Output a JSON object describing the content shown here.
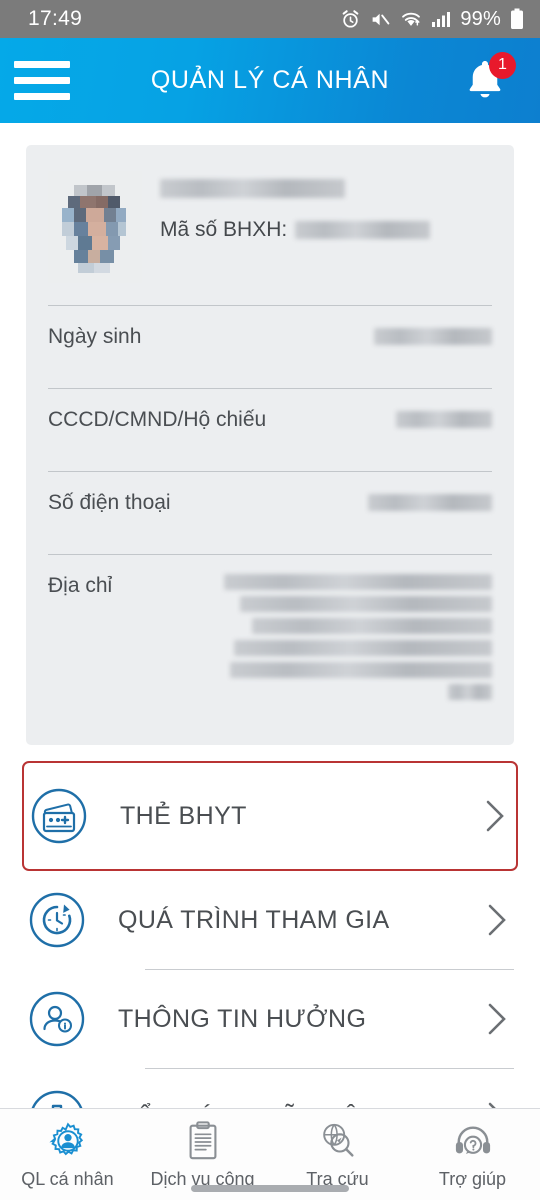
{
  "status_bar": {
    "time": "17:49",
    "battery": "99%",
    "icons": [
      "alarm-icon",
      "mute-icon",
      "wifi-icon",
      "signal-icon",
      "battery-icon"
    ]
  },
  "header": {
    "title": "QUẢN LÝ CÁ NHÂN",
    "menu_icon": "hamburger-icon",
    "notification_icon": "bell-icon",
    "notification_badge": "1"
  },
  "profile": {
    "name_redacted": "",
    "bhxh_label": "Mã số BHXH:",
    "bhxh_value_redacted": "",
    "rows": [
      {
        "label": "Ngày sinh",
        "value_redacted": ""
      },
      {
        "label": "CCCD/CMND/Hộ chiếu",
        "value_redacted": ""
      },
      {
        "label": "Số điện thoại",
        "value_redacted": ""
      },
      {
        "label": "Địa chỉ",
        "value_redacted": ""
      }
    ]
  },
  "menu": {
    "items": [
      {
        "label": "THẺ BHYT",
        "icon": "insurance-card-icon",
        "highlighted": true
      },
      {
        "label": "QUÁ TRÌNH THAM GIA",
        "icon": "history-clock-icon",
        "highlighted": false
      },
      {
        "label": "THÔNG TIN HƯỞNG",
        "icon": "person-info-icon",
        "highlighted": false
      },
      {
        "label": "SỔ KHÁM CHỮA BỆNH",
        "icon": "medical-cross-icon",
        "highlighted": false
      }
    ],
    "chevron_icon": "chevron-right-icon"
  },
  "bottom_nav": {
    "items": [
      {
        "label": "QL cá nhân",
        "icon": "gear-person-icon",
        "active": true
      },
      {
        "label": "Dịch vụ công",
        "icon": "document-icon",
        "active": false
      },
      {
        "label": "Tra cứu",
        "icon": "globe-search-icon",
        "active": false
      },
      {
        "label": "Trợ giúp",
        "icon": "headset-help-icon",
        "active": false
      }
    ]
  },
  "colors": {
    "header_start": "#05a9e8",
    "header_end": "#0d7fcf",
    "status_bar": "#7b7b7b",
    "highlight_border": "#b93434",
    "badge_red": "#e8192c",
    "icon_blue": "#1f6fa8",
    "card_bg": "#eceef0"
  }
}
